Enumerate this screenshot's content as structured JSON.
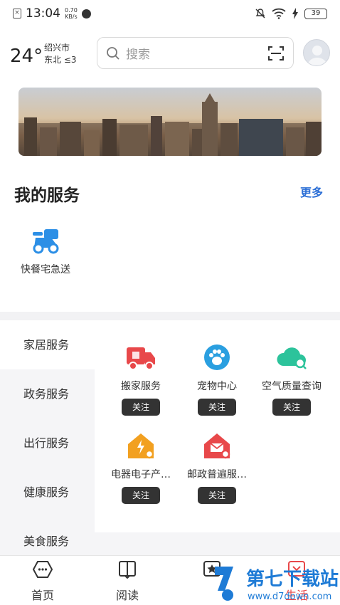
{
  "status_bar": {
    "time": "13:04",
    "speed_value": "0.70",
    "speed_unit": "KB/s",
    "battery": "39"
  },
  "header": {
    "temperature": "24°",
    "city": "绍兴市",
    "wind": "东北 ≤3",
    "search_placeholder": "搜索"
  },
  "my_services": {
    "title": "我的服务",
    "more_label": "更多",
    "items": [
      {
        "label": "快餐宅急送",
        "icon": "delivery-scooter-icon"
      }
    ]
  },
  "categories": [
    {
      "label": "家居服务",
      "active": true
    },
    {
      "label": "政务服务",
      "active": false
    },
    {
      "label": "出行服务",
      "active": false
    },
    {
      "label": "健康服务",
      "active": false
    },
    {
      "label": "美食服务",
      "active": false
    }
  ],
  "services": [
    {
      "name": "搬家服务",
      "icon": "moving-truck-icon",
      "follow": "关注",
      "color": "#e8484a"
    },
    {
      "name": "宠物中心",
      "icon": "pet-paw-icon",
      "follow": "关注",
      "color": "#2a9fe0"
    },
    {
      "name": "空气质量查询",
      "icon": "cloud-search-icon",
      "follow": "关注",
      "color": "#2cc39b"
    },
    {
      "name": "电器电子产…",
      "icon": "house-power-icon",
      "follow": "关注",
      "color": "#f2a020"
    },
    {
      "name": "邮政普遍服…",
      "icon": "house-mail-icon",
      "follow": "关注",
      "color": "#e8484a"
    }
  ],
  "tabs": [
    {
      "label": "首页",
      "icon": "home-bubble-icon"
    },
    {
      "label": "阅读",
      "icon": "book-icon"
    },
    {
      "label": "",
      "icon": "star-icon"
    },
    {
      "label": "生活",
      "icon": "life-icon"
    }
  ],
  "watermark": {
    "text": "第七下载站",
    "url": "www.d7down.com"
  },
  "colors": {
    "accent": "#2c6fd6",
    "follow_button": "#333333",
    "watermark": "#1e7bd6"
  }
}
